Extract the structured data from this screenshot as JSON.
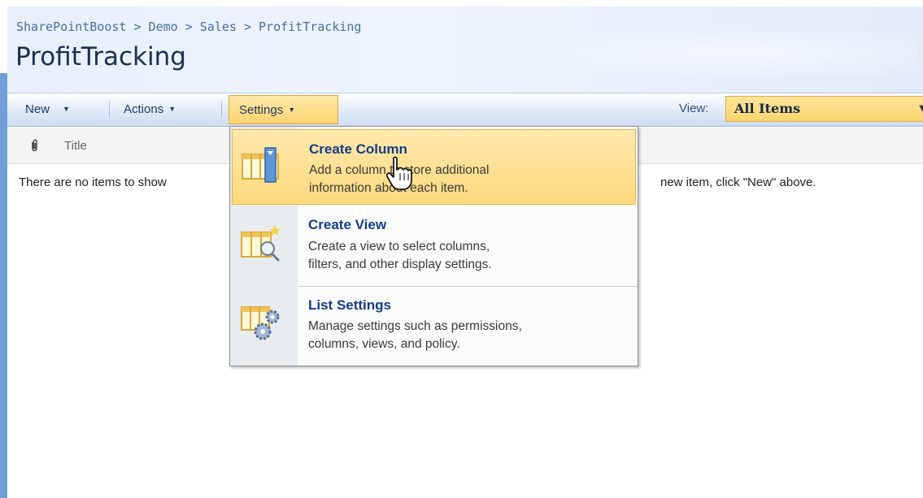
{
  "breadcrumb": "SharePointBoost > Demo > Sales > ProfitTracking",
  "page_title": "ProfitTracking",
  "toolbar": {
    "new_label": "New",
    "actions_label": "Actions",
    "settings_label": "Settings",
    "view_label": "View:",
    "view_value": "All Items"
  },
  "list": {
    "attachment_icon": "paperclip-icon",
    "title_column": "Title",
    "empty_message_left": "There are no items to show",
    "empty_message_right": "new item, click \"New\" above."
  },
  "settings_menu": {
    "items": [
      {
        "title": "Create Column",
        "desc_line1": "Add a column to store additional",
        "desc_line2": "information about each item.",
        "icon": "create-column-icon"
      },
      {
        "title": "Create View",
        "desc_line1": "Create a view to select columns,",
        "desc_line2": "filters, and other display settings.",
        "icon": "create-view-icon"
      },
      {
        "title": "List Settings",
        "desc_line1": "Manage settings such as permissions,",
        "desc_line2": "columns, views, and policy.",
        "icon": "list-settings-icon"
      }
    ]
  },
  "colors": {
    "highlight": "#fcd97c",
    "link_blue": "#123d8a",
    "header_bg": "#e7f0fc"
  }
}
